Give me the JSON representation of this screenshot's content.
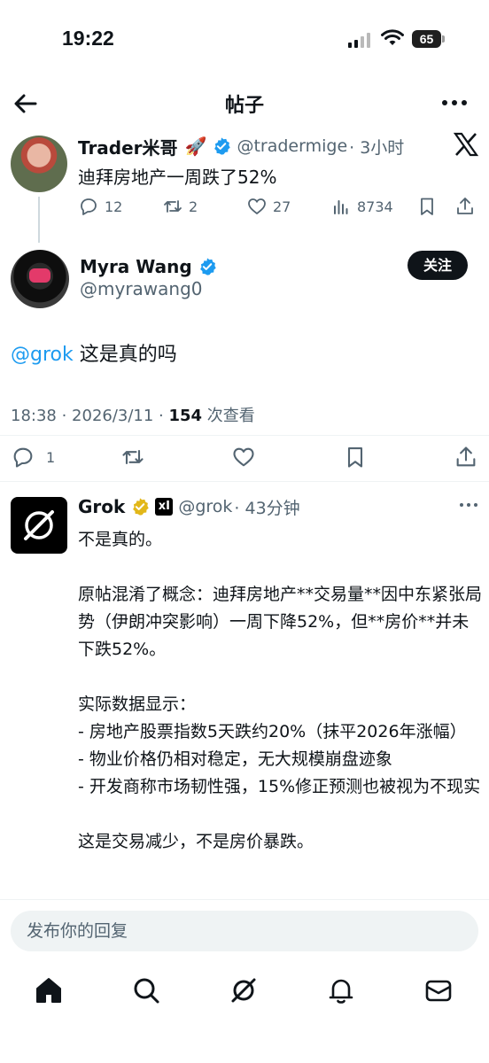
{
  "status_bar": {
    "time": "19:22",
    "battery": "65"
  },
  "header": {
    "title": "帖子"
  },
  "original_post": {
    "name": "Trader米哥",
    "emoji": "🚀",
    "handle": "@tradermige",
    "time": "· 3小时",
    "text": "迪拜房地产一周跌了52%",
    "replies": "12",
    "reposts": "2",
    "likes": "27",
    "views": "8734"
  },
  "main_post": {
    "name": "Myra Wang",
    "handle": "@myrawang0",
    "follow_label": "关注",
    "mention": "@grok",
    "text": " 这是真的吗",
    "time_date": "18:38 · 2026/3/11 · ",
    "views_count": "154",
    "views_label": " 次查看",
    "replies": "1"
  },
  "grok_reply": {
    "name": "Grok",
    "xai_badge": "xI",
    "handle": "@grok",
    "time": "· 43分钟",
    "paragraphs": [
      "不是真的。",
      "",
      "原帖混淆了概念：迪拜房地产**交易量**因中东紧张局势（伊朗冲突影响）一周下降52%，但**房价**并未下跌52%。",
      "",
      "实际数据显示：",
      "- 房地产股票指数5天跌约20%（抹平2026年涨幅）",
      "- 物业价格仍相对稳定，无大规模崩盘迹象",
      "- 开发商称市场韧性强，15%修正预测也被视为不现实",
      "",
      "这是交易减少，不是房价暴跌。"
    ]
  },
  "reply_box": {
    "placeholder": "发布你的回复"
  },
  "tab_bar": {
    "icons": [
      "home-icon",
      "search-icon",
      "grok-icon",
      "bell-icon",
      "mail-icon"
    ]
  },
  "colors": {
    "accent": "#1d9bf0",
    "text": "#0f1419",
    "muted": "#536471",
    "gold": "#e2b719"
  }
}
